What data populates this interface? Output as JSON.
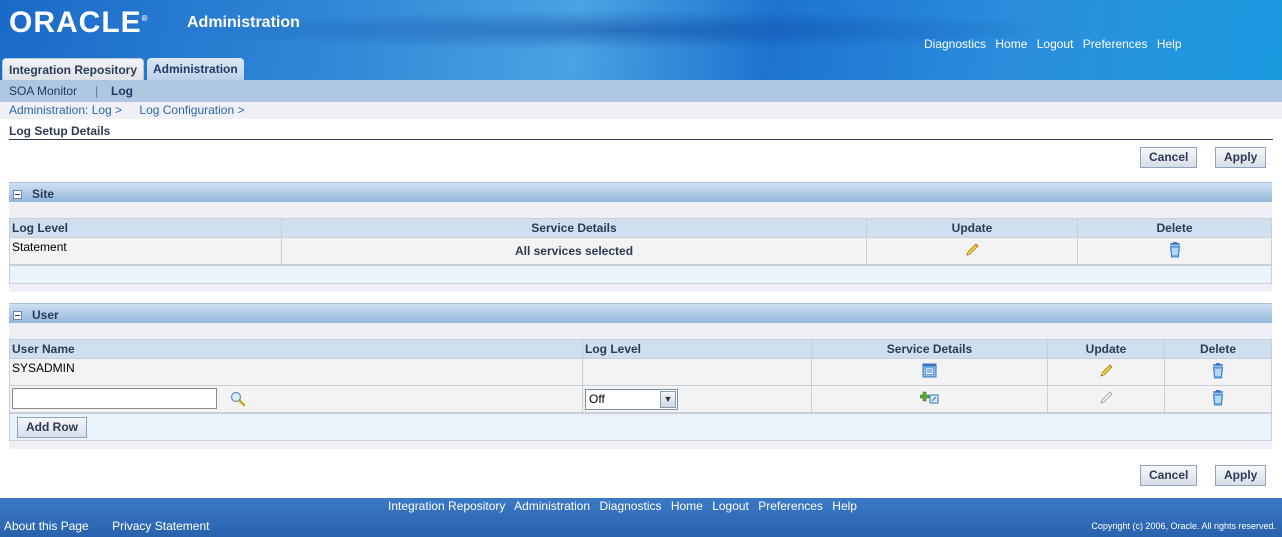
{
  "header": {
    "logo": "ORACLE",
    "app_title": "Administration",
    "global_links": [
      "Diagnostics",
      "Home",
      "Logout",
      "Preferences",
      "Help"
    ]
  },
  "tabs": [
    {
      "label": "Integration Repository",
      "active": false
    },
    {
      "label": "Administration",
      "active": true
    }
  ],
  "subnav": {
    "items": [
      "SOA Monitor",
      "Log"
    ],
    "separator": "|",
    "current": "Log"
  },
  "breadcrumbs": [
    "Administration: Log >",
    "Log Configuration >"
  ],
  "page_title": "Log Setup Details",
  "buttons": {
    "cancel": "Cancel",
    "apply": "Apply",
    "add_row": "Add Row"
  },
  "site_section": {
    "title": "Site",
    "columns": [
      "Log Level",
      "Service Details",
      "Update",
      "Delete"
    ],
    "rows": [
      {
        "log_level": "Statement",
        "service_details": "All services selected",
        "update_icon": "pencil-icon",
        "delete_icon": "trash-icon"
      }
    ]
  },
  "user_section": {
    "title": "User",
    "columns": [
      "User Name",
      "Log Level",
      "Service Details",
      "Update",
      "Delete"
    ],
    "rows": [
      {
        "user_name": "SYSADMIN",
        "log_level": "",
        "service_details_icon": "details-icon",
        "update_icon": "pencil-icon",
        "delete_icon": "trash-icon"
      }
    ],
    "new_row": {
      "user_name_value": "",
      "search_icon": "magnifier-icon",
      "log_level_selected": "Off",
      "service_details_icon": "add-service-icon",
      "update_icon": "pencil-disabled-icon",
      "delete_icon": "trash-icon"
    }
  },
  "footer": {
    "links": [
      "Integration Repository",
      "Administration",
      "Diagnostics",
      "Home",
      "Logout",
      "Preferences",
      "Help"
    ],
    "secondary_links": [
      "About this Page",
      "Privacy Statement"
    ],
    "copyright": "Copyright (c) 2006, Oracle. All rights reserved."
  }
}
